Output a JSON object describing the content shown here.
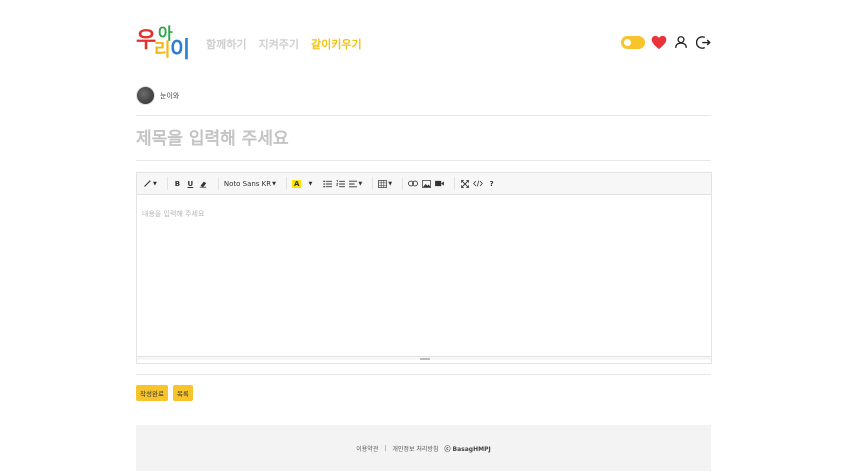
{
  "header": {
    "logo": {
      "chars": [
        "우",
        "아",
        "리",
        "이"
      ]
    },
    "nav": [
      {
        "label": "함께하기",
        "active": false
      },
      {
        "label": "지켜주기",
        "active": false
      },
      {
        "label": "같이키우기",
        "active": true
      }
    ]
  },
  "author": {
    "name": "눈이와"
  },
  "title": {
    "placeholder": "제목을 입력해 주세요"
  },
  "editor": {
    "font_name": "Noto Sans KR",
    "fore_color_label": "A",
    "placeholder": "내용을 입력해 주세요",
    "help_label": "?"
  },
  "actions": {
    "submit": "작성완료",
    "list": "목록"
  },
  "footer": {
    "terms": "이용약관",
    "separator": "|",
    "privacy": "개인정보 처리방침",
    "copyright": "ⓒ BasagHMPJ"
  },
  "colors": {
    "accent": "#f7c52b",
    "nav_active": "#f4c20d",
    "heart": "#e8323c"
  }
}
